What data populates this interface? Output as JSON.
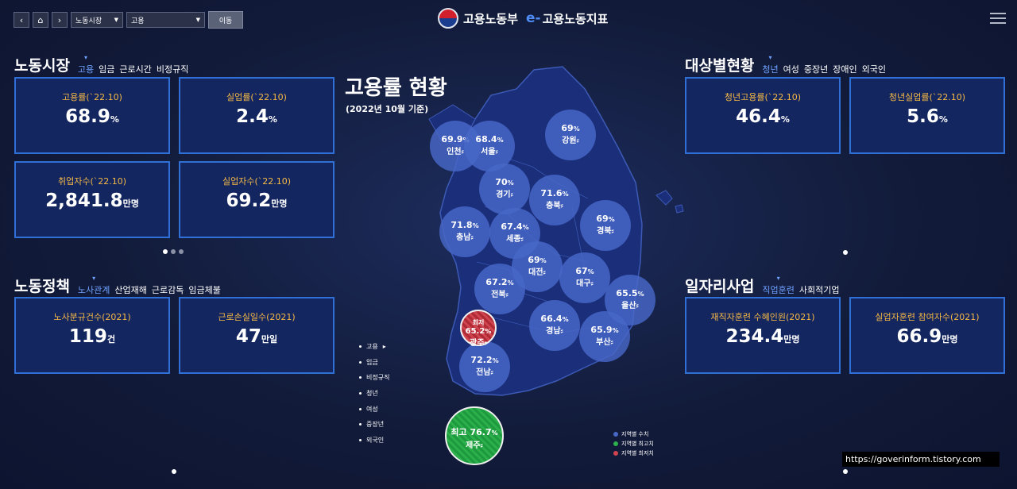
{
  "nav": {
    "back_icon": "chevron-left-icon",
    "home_icon": "home-icon",
    "forward_icon": "chevron-right-icon",
    "select1": "노동시장",
    "select2": "고용",
    "go_label": "이동"
  },
  "brand": {
    "ministry": "고용노동부",
    "e": "e-",
    "title": "고용노동지표"
  },
  "labor_market": {
    "title": "노동시장",
    "tabs": [
      "고용",
      "임금",
      "근로시간",
      "비정규직"
    ],
    "cards": [
      {
        "label": "고용률(`22.10)",
        "value": "68.9",
        "unit": "%"
      },
      {
        "label": "실업률(`22.10)",
        "value": "2.4",
        "unit": "%"
      },
      {
        "label": "취업자수(`22.10)",
        "value": "2,841.8",
        "unit": "만명"
      },
      {
        "label": "실업자수(`22.10)",
        "value": "69.2",
        "unit": "만명"
      }
    ]
  },
  "labor_policy": {
    "title": "노동정책",
    "tabs": [
      "노사관계",
      "산업재해",
      "근로감독",
      "임금체불"
    ],
    "cards": [
      {
        "label": "노사분규건수(2021)",
        "value": "119",
        "unit": "건"
      },
      {
        "label": "근로손실일수(2021)",
        "value": "47",
        "unit": "만일"
      }
    ]
  },
  "target_status": {
    "title": "대상별현황",
    "tabs": [
      "청년",
      "여성",
      "중장년",
      "장애인",
      "외국인"
    ],
    "cards": [
      {
        "label": "청년고용률(`22.10)",
        "value": "46.4",
        "unit": "%"
      },
      {
        "label": "청년실업률(`22.10)",
        "value": "5.6",
        "unit": "%"
      }
    ]
  },
  "job_program": {
    "title": "일자리사업",
    "tabs": [
      "직업훈련",
      "사회적기업"
    ],
    "cards": [
      {
        "label": "재직자훈련 수혜인원(2021)",
        "value": "234.4",
        "unit": "만명"
      },
      {
        "label": "실업자훈련 참여자수(2021)",
        "value": "66.9",
        "unit": "만명"
      }
    ]
  },
  "map": {
    "title": "고용률 현황",
    "subtitle": "(2022년 10월 기준)",
    "regions": [
      {
        "name": "인천",
        "value": "69.9",
        "unit": "%"
      },
      {
        "name": "서울",
        "value": "68.4",
        "unit": "%"
      },
      {
        "name": "강원",
        "value": "69",
        "unit": "%"
      },
      {
        "name": "경기",
        "value": "70",
        "unit": "%"
      },
      {
        "name": "충북",
        "value": "71.6",
        "unit": "%"
      },
      {
        "name": "충남",
        "value": "71.8",
        "unit": "%"
      },
      {
        "name": "세종",
        "value": "67.4",
        "unit": "%"
      },
      {
        "name": "경북",
        "value": "69",
        "unit": "%"
      },
      {
        "name": "대전",
        "value": "69",
        "unit": "%"
      },
      {
        "name": "대구",
        "value": "67",
        "unit": "%"
      },
      {
        "name": "전북",
        "value": "67.2",
        "unit": "%"
      },
      {
        "name": "울산",
        "value": "65.5",
        "unit": "%"
      },
      {
        "name": "경남",
        "value": "66.4",
        "unit": "%"
      },
      {
        "name": "부산",
        "value": "65.9",
        "unit": "%"
      },
      {
        "name": "전남",
        "value": "72.2",
        "unit": "%"
      }
    ],
    "lowest": {
      "prefix": "최저",
      "name": "광주",
      "value": "65.2",
      "unit": "%"
    },
    "highest": {
      "prefix": "최고",
      "name": "제주",
      "value": "76.7",
      "unit": "%"
    },
    "side_menu": [
      "고용",
      "임금",
      "비정규직",
      "청년",
      "여성",
      "중장년",
      "외국인"
    ],
    "legend": [
      {
        "label": "지역별 수치",
        "color": "#4868c8"
      },
      {
        "label": "지역별 최고치",
        "color": "#2cb04c"
      },
      {
        "label": "지역별 최저치",
        "color": "#d04450"
      }
    ]
  },
  "url": "https://goverinform.tistory.com",
  "colors": {
    "accent": "#2f6fd6",
    "label": "#f5b944",
    "tab_active": "#6fa2ff"
  }
}
